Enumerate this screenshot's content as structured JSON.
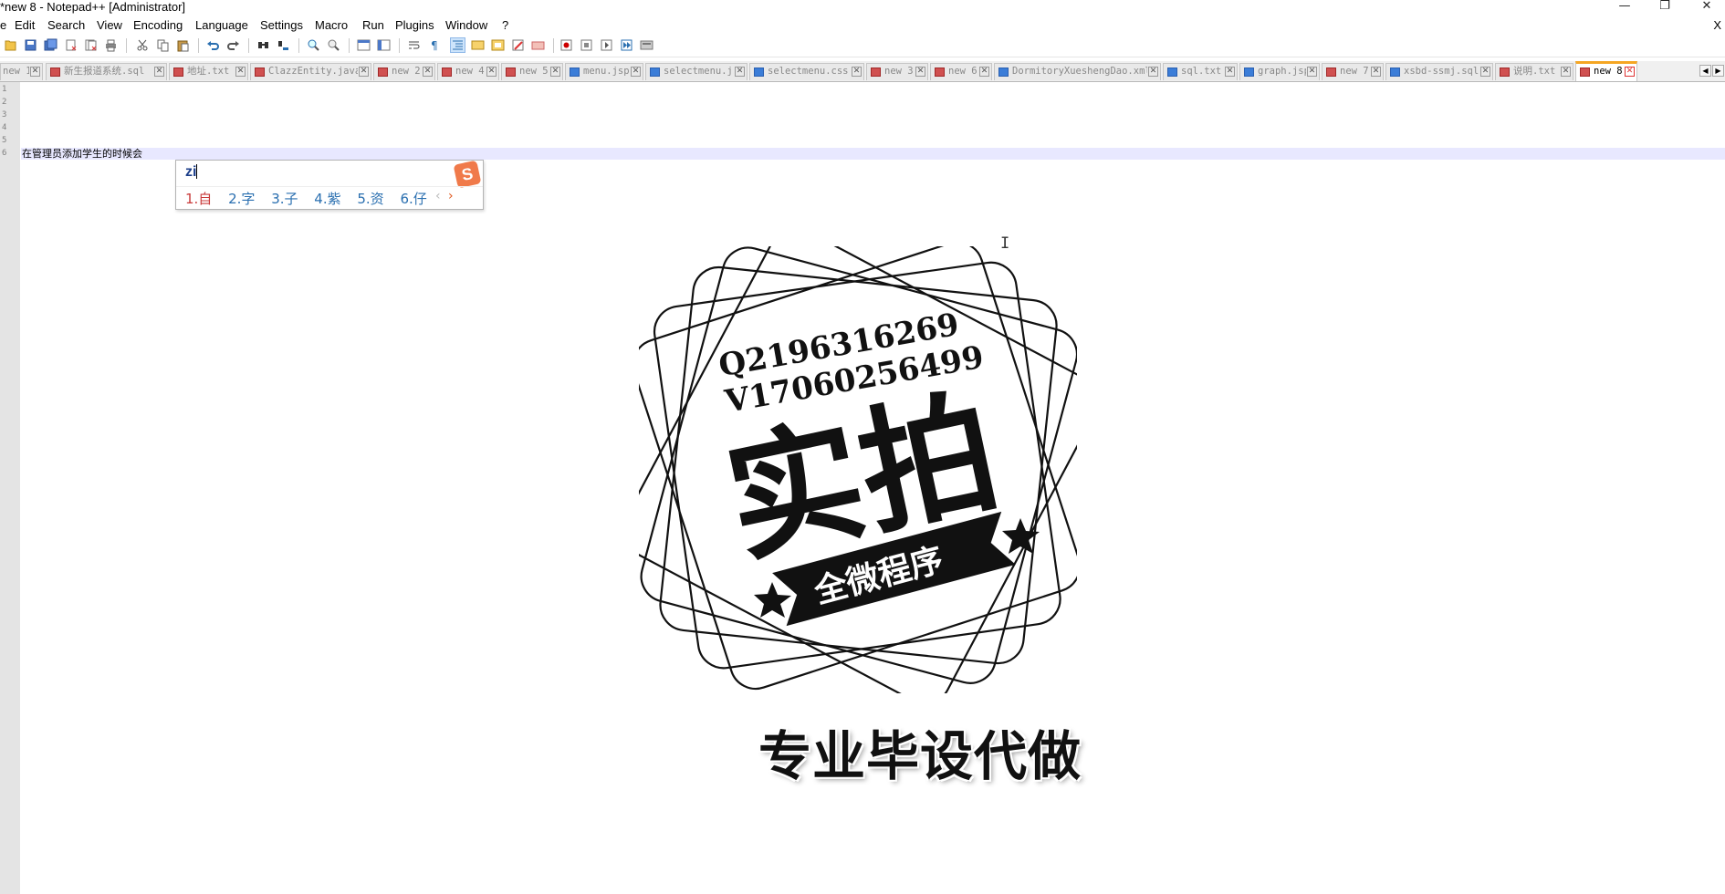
{
  "window": {
    "title": "*new 8 - Notepad++ [Administrator]",
    "minimize_glyph": "—",
    "restore_glyph": "❐",
    "close_glyph": "✕",
    "doc_close_glyph": "X"
  },
  "menu": {
    "items": [
      "e",
      "Edit",
      "Search",
      "View",
      "Encoding",
      "Language",
      "Settings",
      "Macro",
      "Run",
      "Plugins",
      "Window",
      "?"
    ]
  },
  "toolbar": {
    "icons": [
      "new-file-icon",
      "open-file-icon",
      "save-icon",
      "save-all-icon",
      "close-icon",
      "close-all-icon",
      "print-icon",
      "cut-icon",
      "copy-icon",
      "paste-icon",
      "undo-icon",
      "redo-icon",
      "find-icon",
      "replace-icon",
      "zoom-in-icon",
      "zoom-out-icon",
      "sync-vertical-icon",
      "sync-horizontal-icon",
      "word-wrap-icon",
      "show-all-chars-icon",
      "indent-guide-icon",
      "user-lang-icon",
      "doc-map-icon",
      "function-list-icon",
      "folder-workspace-icon",
      "record-macro-icon",
      "stop-record-icon",
      "play-macro-icon",
      "run-macro-multiple-icon",
      "save-macro-icon"
    ]
  },
  "tabs": [
    {
      "label": "new 1",
      "state": "modified"
    },
    {
      "label": "新生报道系统.sql",
      "state": "modified"
    },
    {
      "label": "地址.txt",
      "state": "modified"
    },
    {
      "label": "ClazzEntity.java",
      "state": "modified"
    },
    {
      "label": "new 2",
      "state": "modified"
    },
    {
      "label": "new 4",
      "state": "modified"
    },
    {
      "label": "new 5",
      "state": "modified"
    },
    {
      "label": "menu.jsp",
      "state": "saved"
    },
    {
      "label": "selectmenu.js",
      "state": "saved"
    },
    {
      "label": "selectmenu.css",
      "state": "saved"
    },
    {
      "label": "new 3",
      "state": "modified"
    },
    {
      "label": "new 6",
      "state": "modified"
    },
    {
      "label": "DormitoryXueshengDao.xml",
      "state": "saved"
    },
    {
      "label": "sql.txt",
      "state": "saved"
    },
    {
      "label": "graph.jsp",
      "state": "saved"
    },
    {
      "label": "new 7",
      "state": "modified"
    },
    {
      "label": "xsbd-ssmj.sql",
      "state": "saved"
    },
    {
      "label": "说明.txt",
      "state": "modified"
    },
    {
      "label": "new 8",
      "state": "active"
    }
  ],
  "tab_nav": {
    "left": "◀",
    "right": "▶"
  },
  "editor": {
    "line_numbers": [
      "1",
      "2",
      "3",
      "4",
      "5",
      "6"
    ],
    "current_line_text": "在管理员添加学生的时候会"
  },
  "ime": {
    "input": "zi",
    "candidates": [
      "1.自",
      "2.字",
      "3.子",
      "4.紫",
      "5.资",
      "6.仔"
    ],
    "prev": "‹",
    "next": "›",
    "logo": "S"
  },
  "cursor_glyph": "I",
  "watermark": {
    "contact_q": "Q2196316269",
    "contact_v": "V17060256499",
    "big_text": "实拍",
    "ribbon_text": "全微程序",
    "footer": "专业毕设代做"
  },
  "colors": {
    "tab_active_accent": "#f5a623",
    "current_line": "#e8e8ff",
    "ime_candidate_first": "#c93a3a",
    "ime_candidate": "#2a6fb0"
  }
}
